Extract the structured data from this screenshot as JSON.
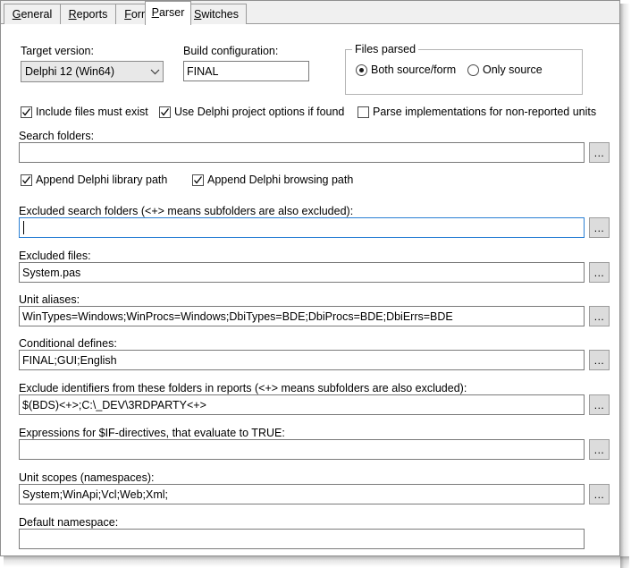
{
  "window": {
    "title": "Parser"
  },
  "tabs": [
    {
      "label": "General",
      "accel": "G",
      "active": false
    },
    {
      "label": "Reports",
      "accel": "R",
      "active": false
    },
    {
      "label": "Format",
      "accel": "F",
      "active": false
    },
    {
      "label": "Parser",
      "accel": "P",
      "active": true
    },
    {
      "label": "Switches",
      "accel": "S",
      "active": false
    }
  ],
  "target_version": {
    "label": "Target version:",
    "value": "Delphi 12 (Win64)",
    "icon": "chevron-down-icon"
  },
  "build_configuration": {
    "label": "Build configuration:",
    "value": "FINAL",
    "placeholder": ""
  },
  "files_parsed": {
    "title": "Files parsed",
    "options": [
      {
        "label": "Both source/form",
        "selected": true
      },
      {
        "label": "Only source",
        "selected": false
      }
    ]
  },
  "checkboxes_row1": [
    {
      "label": "Include files must exist",
      "checked": true
    },
    {
      "label": "Use Delphi project options if found",
      "checked": true
    },
    {
      "label": "Parse implementations for non-reported units",
      "checked": false
    }
  ],
  "checkboxes_row2": [
    {
      "label": "Append Delphi library path",
      "checked": true
    },
    {
      "label": "Append Delphi browsing path",
      "checked": true
    }
  ],
  "fields": [
    {
      "label": "Search folders:",
      "value": "",
      "placeholder": "",
      "focused": false,
      "has_browse": true
    },
    {
      "label": "Excluded search folders (<+> means subfolders are also excluded):",
      "value": "",
      "placeholder": "",
      "focused": true,
      "has_browse": true
    },
    {
      "label": "Excluded files:",
      "value": "System.pas",
      "placeholder": "",
      "focused": false,
      "has_browse": true
    },
    {
      "label": "Unit aliases:",
      "value": "WinTypes=Windows;WinProcs=Windows;DbiTypes=BDE;DbiProcs=BDE;DbiErrs=BDE",
      "placeholder": "",
      "focused": false,
      "has_browse": true
    },
    {
      "label": "Conditional defines:",
      "value": "FINAL;GUI;English",
      "placeholder": "",
      "focused": false,
      "has_browse": true
    },
    {
      "label": "Exclude identifiers from these folders in reports (<+> means subfolders are also excluded):",
      "value": "$(BDS)<+>;C:\\_DEV\\3RDPARTY<+>",
      "placeholder": "",
      "focused": false,
      "has_browse": true
    },
    {
      "label": "Expressions for $IF-directives, that evaluate to TRUE:",
      "value": "",
      "placeholder": "",
      "focused": false,
      "has_browse": true
    },
    {
      "label": "Unit scopes (namespaces):",
      "value": "System;WinApi;Vcl;Web;Xml;",
      "placeholder": "",
      "focused": false,
      "has_browse": true
    },
    {
      "label": "Default namespace:",
      "value": "",
      "placeholder": "",
      "focused": false,
      "has_browse": false
    }
  ],
  "browse_button_label": "...",
  "colors": {
    "focus_border": "#2a7fd4",
    "field_border": "#7a7a7a",
    "tab_border": "#9a9a9a",
    "group_border": "#b4b4b4",
    "combo_fill": "#e8e8e8",
    "button_fill": "#dcdcdc",
    "pane_bg": "#ffffff",
    "tabstrip_bg": "#f0f0f0"
  }
}
